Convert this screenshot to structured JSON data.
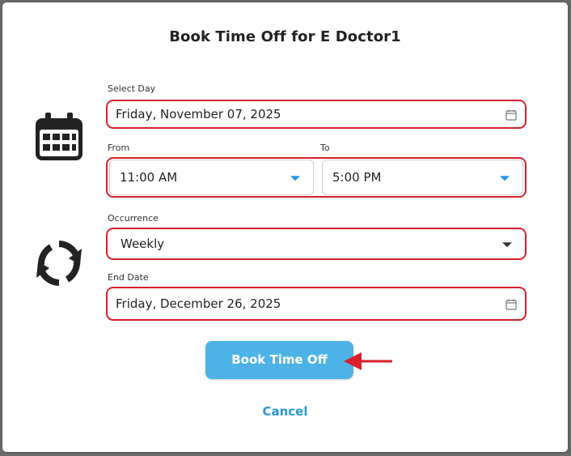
{
  "dialog": {
    "title": "Book Time Off for E Doctor1"
  },
  "select_day": {
    "label": "Select Day",
    "value": "Friday, November 07, 2025",
    "icon": "calendar-icon"
  },
  "time_range": {
    "from_label": "From",
    "from_value": "11:00 AM",
    "to_label": "To",
    "to_value": "5:00 PM"
  },
  "occurrence": {
    "label": "Occurrence",
    "value": "Weekly"
  },
  "end_date": {
    "label": "End Date",
    "value": "Friday, December 26, 2025"
  },
  "actions": {
    "book_label": "Book Time Off",
    "cancel_label": "Cancel"
  },
  "colors": {
    "highlight_border": "#d9202b",
    "primary_button": "#4db3e6",
    "link": "#2a97d4",
    "dropdown_arrow": "#2196f3",
    "annotation_arrow": "#d9202b"
  },
  "icons": {
    "left_top": "calendar-icon",
    "left_bottom": "refresh-cycle-icon",
    "annotation": "red-arrow-pointer-icon"
  }
}
